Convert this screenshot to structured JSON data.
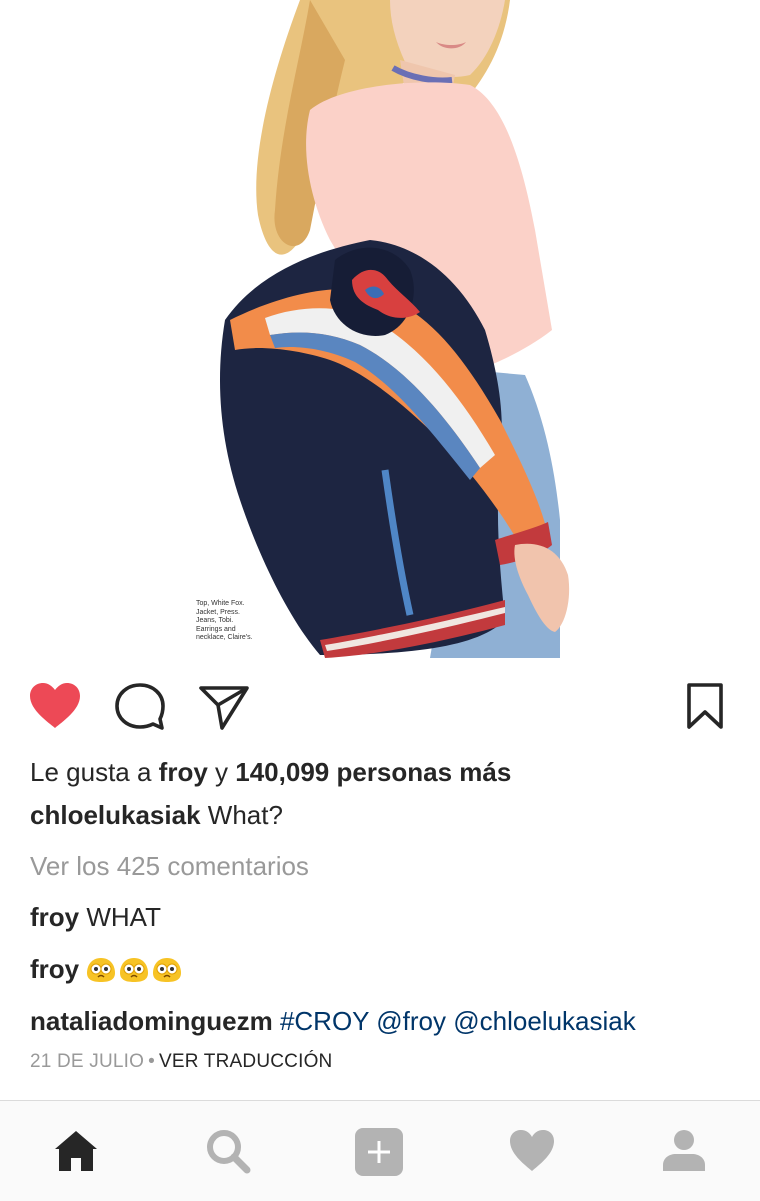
{
  "post": {
    "photo_credits": [
      "Top, White Fox.",
      "Jacket, Press.",
      "Jeans, Tobi.",
      "Earrings and",
      "necklace, Claire's."
    ],
    "likes_prefix": "Le gusta a",
    "likes_user": "froy",
    "likes_connector": "y",
    "likes_count": "140,099 personas más",
    "author": "chloelukasiak",
    "caption": "What?",
    "view_comments": "Ver los 425 comentarios",
    "comments": [
      {
        "user": "froy",
        "text": "WHAT"
      },
      {
        "user": "froy",
        "emoji_count": 3,
        "emoji": "flushed-face"
      },
      {
        "user": "nataliadominguezm",
        "tags": [
          "#CROY",
          "@froy",
          "@chloelukasiak"
        ]
      }
    ],
    "date": "21 DE JULIO",
    "separator": "•",
    "translate": "VER TRADUCCIÓN"
  },
  "actions": {
    "icons": [
      "heart-filled-icon",
      "comment-icon",
      "share-icon",
      "bookmark-icon"
    ],
    "like_color": "#ed4956"
  },
  "tabbar": {
    "icons": [
      "home-icon",
      "search-icon",
      "add-post-icon",
      "activity-heart-icon",
      "profile-icon"
    ],
    "active": "home-icon"
  }
}
